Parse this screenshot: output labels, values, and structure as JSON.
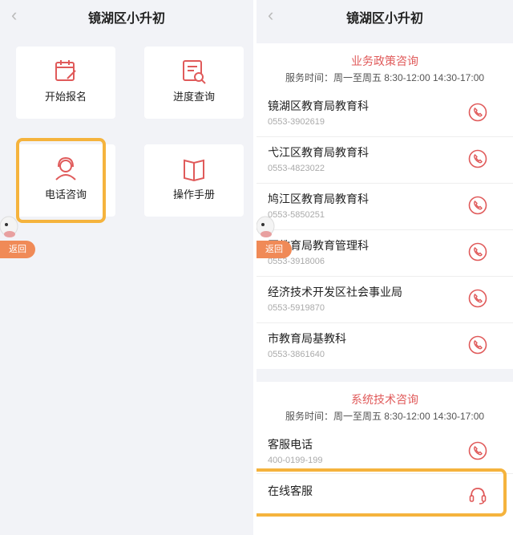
{
  "left": {
    "title": "镜湖区小升初",
    "tiles": [
      {
        "label": "开始报名",
        "icon": "calendar-edit-icon"
      },
      {
        "label": "进度查询",
        "icon": "document-search-icon"
      },
      {
        "label": "电话咨询",
        "icon": "headset-agent-icon"
      },
      {
        "label": "操作手册",
        "icon": "book-icon"
      }
    ],
    "float_back": "返回"
  },
  "right": {
    "title": "镜湖区小升初",
    "float_back": "返回",
    "policy": {
      "heading": "业务政策咨询",
      "hours": "服务时间：周一至周五 8:30-12:00 14:30-17:00",
      "contacts": [
        {
          "name": "镜湖区教育局教育科",
          "phone": "0553-3902619"
        },
        {
          "name": "弋江区教育局教育科",
          "phone": "0553-4823022"
        },
        {
          "name": "鸠江区教育局教育科",
          "phone": "0553-5850251"
        },
        {
          "name": "区教育局教育管理科",
          "phone": "0553-3918006"
        },
        {
          "name": "经济技术开发区社会事业局",
          "phone": "0553-5919870"
        },
        {
          "name": "市教育局基教科",
          "phone": "0553-3861640"
        }
      ]
    },
    "tech": {
      "heading": "系统技术咨询",
      "hours": "服务时间：周一至周五 8:30-12:00 14:30-17:00",
      "hotline_name": "客服电话",
      "hotline_phone": "400-0199-199",
      "online_name": "在线客服"
    }
  },
  "colors": {
    "accent": "#e05a5a",
    "highlight": "#f5b33d",
    "float_back": "#f08a57"
  }
}
